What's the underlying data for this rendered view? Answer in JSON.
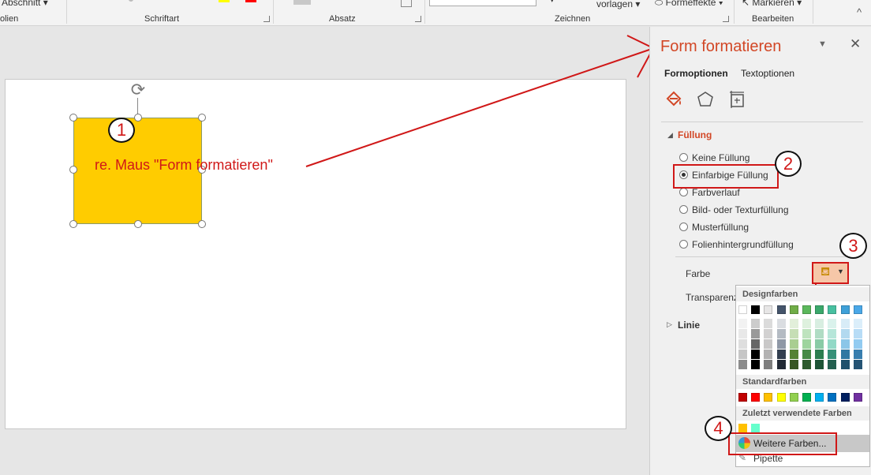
{
  "ribbon": {
    "abschnitt": "Abschnitt",
    "vorlagen": "vorlagen",
    "formeffekte": "Formeffekte",
    "markieren": "Markieren",
    "groups": {
      "folien": "olien",
      "schriftart": "Schriftart",
      "absatz": "Absatz",
      "zeichnen": "Zeichnen",
      "bearbeiten": "Bearbeiten"
    }
  },
  "slide": {
    "shape_text": "re. Maus \"Form formatieren\"",
    "shape_color": "#ffcc00"
  },
  "annotations": {
    "n1": "1",
    "n2": "2",
    "n3": "3",
    "n4": "4"
  },
  "pane": {
    "title": "Form formatieren",
    "tabs": [
      "Formoptionen",
      "Textoptionen"
    ],
    "fill_section": "Füllung",
    "fill_options": [
      "Keine Füllung",
      "Einfarbige Füllung",
      "Farbverlauf",
      "Bild- oder Texturfüllung",
      "Musterfüllung",
      "Folienhintergrundfüllung"
    ],
    "selected_fill": "Einfarbige Füllung",
    "color_label": "Farbe",
    "transparency_label": "Transparenz",
    "line_section": "Linie",
    "accent_color": "#d24726"
  },
  "dropdown": {
    "design_header": "Designfarben",
    "standard_header": "Standardfarben",
    "recent_header": "Zuletzt verwendete Farben",
    "more_colors": "Weitere Farben...",
    "eyedropper": "Pipette",
    "theme_colors": [
      "#ffffff",
      "#000000",
      "#e7e6e6",
      "#44546a",
      "#70ad47",
      "#5cb85c",
      "#3aa86b",
      "#48c0a0",
      "#3ea0d8",
      "#4aa8e8"
    ],
    "standard_colors": [
      "#c00000",
      "#ff0000",
      "#ffc000",
      "#ffff00",
      "#92d050",
      "#00b050",
      "#00b0f0",
      "#0070c0",
      "#002060",
      "#7030a0"
    ],
    "recent_colors": [
      "#ffc000",
      "#66ffcc"
    ]
  },
  "icons": [
    "paint-bucket-icon",
    "pentagon-icon",
    "size-properties-icon",
    "rotate-icon",
    "dropdown-arrow-icon",
    "close-icon",
    "color-wheel-icon",
    "eyedropper-icon"
  ]
}
